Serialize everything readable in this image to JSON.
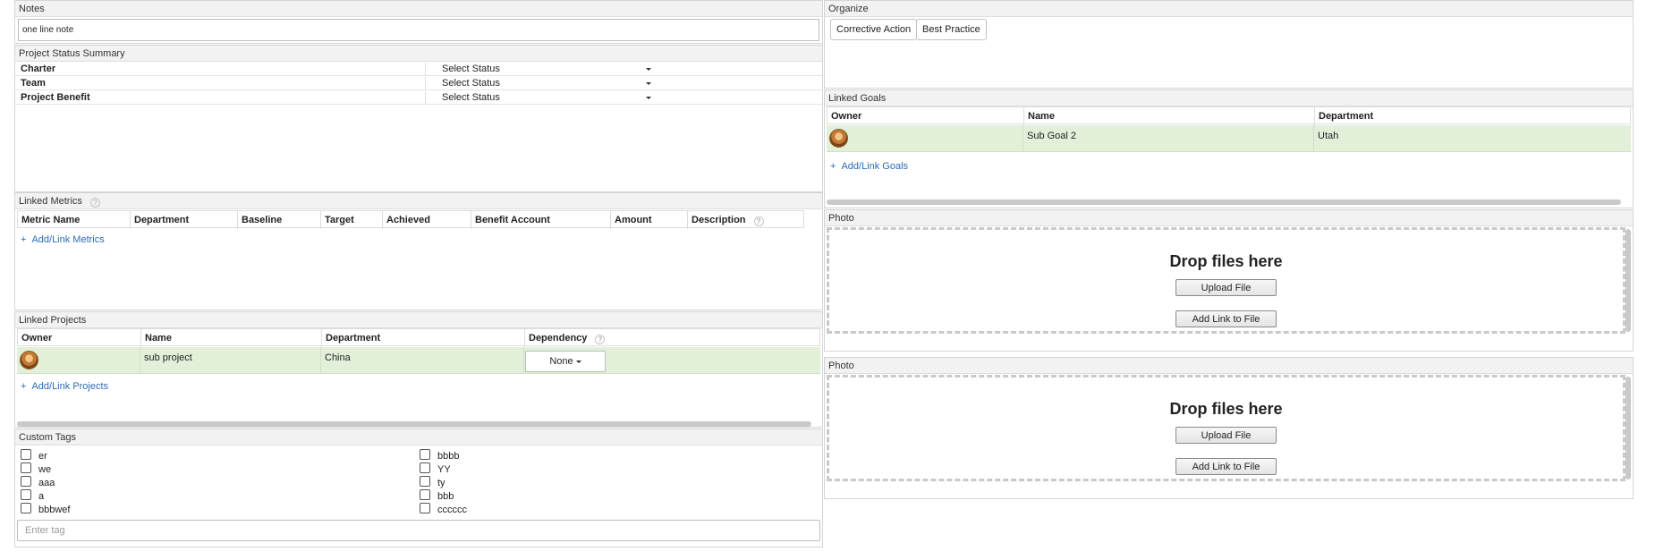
{
  "notes": {
    "title": "Notes",
    "value": "one line note"
  },
  "status_summary": {
    "title": "Project Status Summary",
    "rows": [
      {
        "label": "Charter",
        "value": "Select Status"
      },
      {
        "label": "Team",
        "value": "Select Status"
      },
      {
        "label": "Project Benefit",
        "value": "Select Status"
      }
    ]
  },
  "linked_metrics": {
    "title": "Linked Metrics",
    "columns": [
      "Metric Name",
      "Department",
      "Baseline",
      "Target",
      "Achieved",
      "Benefit Account",
      "Amount",
      "Description"
    ],
    "add_label": "Add/Link Metrics"
  },
  "linked_projects": {
    "title": "Linked Projects",
    "columns": [
      "Owner",
      "Name",
      "Department",
      "Dependency"
    ],
    "rows": [
      {
        "name": "sub project",
        "department": "China",
        "dependency": "None"
      }
    ],
    "add_label": "Add/Link Projects"
  },
  "custom_tags": {
    "title": "Custom Tags",
    "left": [
      "er",
      "we",
      "aaa",
      "a",
      "bbbwef"
    ],
    "right": [
      "bbbb",
      "YY",
      "ty",
      "bbb",
      "cccccc"
    ],
    "input_placeholder": "Enter tag"
  },
  "organize": {
    "title": "Organize",
    "buttons": [
      "Corrective Action",
      "Best Practice"
    ]
  },
  "linked_goals": {
    "title": "Linked Goals",
    "columns": [
      "Owner",
      "Name",
      "Department"
    ],
    "rows": [
      {
        "name": "Sub Goal 2",
        "department": "Utah"
      }
    ],
    "add_label": "Add/Link Goals"
  },
  "photos": [
    {
      "title": "Photo",
      "drop_text": "Drop files here",
      "upload_label": "Upload File",
      "link_label": "Add Link to File"
    },
    {
      "title": "Photo",
      "drop_text": "Drop files here",
      "upload_label": "Upload File",
      "link_label": "Add Link to File"
    }
  ],
  "colors": {
    "link": "#2a6db3",
    "row_highlight": "#e2f0d9",
    "panel_header": "#f2f2f2"
  }
}
